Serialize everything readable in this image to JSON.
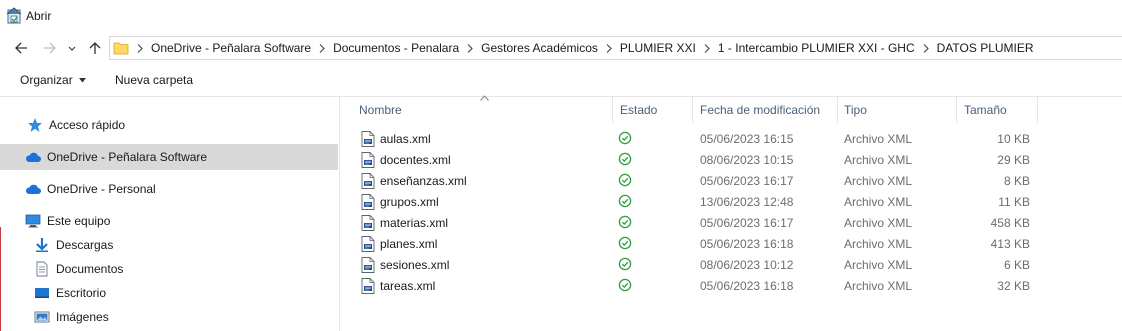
{
  "window": {
    "title": "Abrir",
    "app_icon": "open-dialog-icon"
  },
  "address": {
    "folder_icon": "folder-icon",
    "crumbs": [
      "OneDrive - Peñalara Software",
      "Documentos - Penalara",
      "Gestores Académicos",
      "PLUMIER XXI",
      "1 - Intercambio PLUMIER XXI - GHC",
      "DATOS PLUMIER"
    ]
  },
  "toolbar": {
    "organize_label": "Organizar",
    "new_folder_label": "Nueva carpeta"
  },
  "nav": {
    "items": [
      {
        "label": "Acceso rápido",
        "icon": "star-icon"
      },
      {
        "label": "OneDrive - Peñalara Software",
        "icon": "cloud-icon",
        "selected": true
      },
      {
        "label": "OneDrive - Personal",
        "icon": "cloud-icon"
      },
      {
        "label": "Este equipo",
        "icon": "computer-icon"
      },
      {
        "label": "Descargas",
        "icon": "download-icon"
      },
      {
        "label": "Documentos",
        "icon": "document-icon"
      },
      {
        "label": "Escritorio",
        "icon": "desktop-icon"
      },
      {
        "label": "Imágenes",
        "icon": "image-icon"
      }
    ]
  },
  "columns": {
    "name": "Nombre",
    "status": "Estado",
    "modified": "Fecha de modificación",
    "type": "Tipo",
    "size": "Tamaño"
  },
  "files": [
    {
      "name": "aulas.xml",
      "modified": "05/06/2023 16:15",
      "type": "Archivo XML",
      "size": "10 KB"
    },
    {
      "name": "docentes.xml",
      "modified": "08/06/2023 10:15",
      "type": "Archivo XML",
      "size": "29 KB"
    },
    {
      "name": "enseñanzas.xml",
      "modified": "05/06/2023 16:17",
      "type": "Archivo XML",
      "size": "8 KB"
    },
    {
      "name": "grupos.xml",
      "modified": "13/06/2023 12:48",
      "type": "Archivo XML",
      "size": "11 KB"
    },
    {
      "name": "materias.xml",
      "modified": "05/06/2023 16:17",
      "type": "Archivo XML",
      "size": "458 KB"
    },
    {
      "name": "planes.xml",
      "modified": "05/06/2023 16:18",
      "type": "Archivo XML",
      "size": "413 KB"
    },
    {
      "name": "sesiones.xml",
      "modified": "08/06/2023 10:12",
      "type": "Archivo XML",
      "size": "6 KB"
    },
    {
      "name": "tareas.xml",
      "modified": "05/06/2023 16:18",
      "type": "Archivo XML",
      "size": "32 KB"
    }
  ],
  "colors": {
    "sync_ok": "#2e9d3f",
    "selected_bg": "#d9d9d9",
    "onedrive_blue": "#1a73d8",
    "header_text": "#4c607a"
  }
}
